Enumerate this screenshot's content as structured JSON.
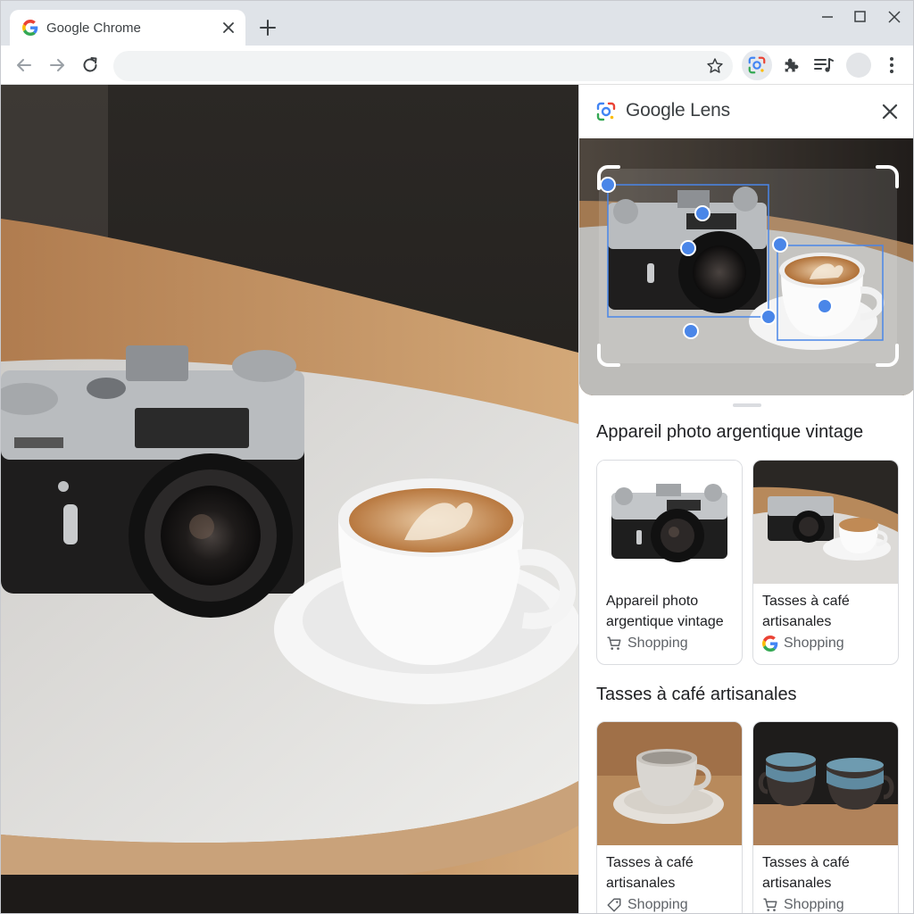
{
  "window": {
    "tab_title": "Google Chrome",
    "omnibox_value": ""
  },
  "icons": {
    "tab_favicon": "google-g-icon",
    "tab_close": "close-icon",
    "new_tab": "plus-icon",
    "back": "arrow-left-icon",
    "forward": "arrow-right-icon",
    "reload": "reload-icon",
    "bookmark": "star-icon",
    "lens": "google-lens-icon",
    "extensions": "puzzle-icon",
    "reading_list": "reading-list-icon",
    "menu": "kebab-menu-icon"
  },
  "lens": {
    "title": "Google Lens",
    "sections": [
      {
        "title": "Appareil photo argentique vintage",
        "cards": [
          {
            "title": "Appareil photo argentique vintage",
            "source": "Shopping",
            "source_icon": "cart-icon"
          },
          {
            "title": "Tasses à café artisanales",
            "source": "Shopping",
            "source_icon": "google-g-icon"
          }
        ]
      },
      {
        "title": "Tasses à café artisanales",
        "cards": [
          {
            "title": "Tasses à café artisanales",
            "source": "Shopping",
            "source_icon": "tag-icon"
          },
          {
            "title": "Tasses à café artisanales",
            "source": "Shopping",
            "source_icon": "cart-icon"
          }
        ]
      }
    ]
  },
  "colors": {
    "accent_blue": "#4a86e8",
    "tabstrip": "#dfe3e8"
  }
}
